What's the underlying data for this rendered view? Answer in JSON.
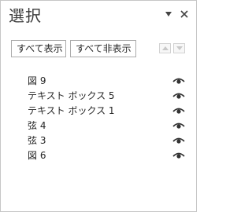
{
  "pane": {
    "title": "選択",
    "controls": [
      {
        "name": "pane-options-icon",
        "glyph": "▾"
      },
      {
        "name": "close-icon",
        "glyph": "✕"
      }
    ]
  },
  "toolbar": {
    "show_all_label": "すべて表示",
    "hide_all_label": "すべて非表示",
    "bring_forward_icon": "triangle-up-icon",
    "send_backward_icon": "triangle-down-icon"
  },
  "objects": [
    {
      "label": "図 9",
      "visible_icon": "eye-icon"
    },
    {
      "label": "テキスト ボックス 5",
      "visible_icon": "eye-icon"
    },
    {
      "label": "テキスト ボックス 1",
      "visible_icon": "eye-icon"
    },
    {
      "label": "弦 4",
      "visible_icon": "eye-icon"
    },
    {
      "label": "弦 3",
      "visible_icon": "eye-icon"
    },
    {
      "label": "図 6",
      "visible_icon": "eye-icon"
    }
  ],
  "colors": {
    "border": "#c6c6c6",
    "button_border": "#ababab",
    "text": "#262626",
    "disabled_arrow": "#c8c8c8"
  }
}
